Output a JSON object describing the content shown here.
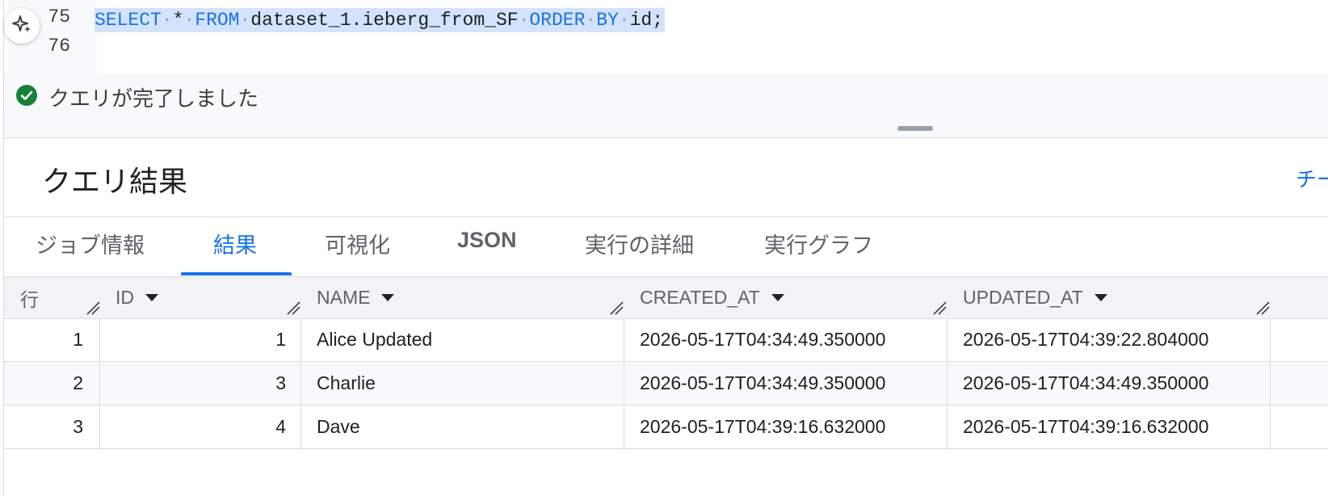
{
  "editor": {
    "lines": [
      {
        "number": "75",
        "tokens": [
          {
            "text": "SELECT",
            "kind": "keyword"
          },
          {
            "text": "·",
            "kind": "space"
          },
          {
            "text": "*",
            "kind": "plain"
          },
          {
            "text": "·",
            "kind": "space"
          },
          {
            "text": "FROM",
            "kind": "keyword"
          },
          {
            "text": "·",
            "kind": "space"
          },
          {
            "text": "dataset_1.ieberg_from_SF",
            "kind": "plain"
          },
          {
            "text": "·",
            "kind": "space"
          },
          {
            "text": "ORDER",
            "kind": "keyword"
          },
          {
            "text": "·",
            "kind": "space"
          },
          {
            "text": "BY",
            "kind": "keyword"
          },
          {
            "text": "·",
            "kind": "space"
          },
          {
            "text": "id;",
            "kind": "plain"
          }
        ],
        "selected": true
      },
      {
        "number": "76",
        "tokens": [],
        "selected": false
      }
    ],
    "ai_icon": "sparkle-icon"
  },
  "status": {
    "icon": "check-circle-icon",
    "text": "クエリが完了しました",
    "color": "#188038"
  },
  "results": {
    "title": "クエリ結果",
    "right_link": "チー"
  },
  "tabs": [
    {
      "label": "ジョブ情報",
      "active": false
    },
    {
      "label": "結果",
      "active": true
    },
    {
      "label": "可視化",
      "active": false
    },
    {
      "label": "JSON",
      "active": false
    },
    {
      "label": "実行の詳細",
      "active": false
    },
    {
      "label": "実行グラフ",
      "active": false
    }
  ],
  "table": {
    "columns": [
      "行",
      "ID",
      "NAME",
      "CREATED_AT",
      "UPDATED_AT"
    ],
    "sortable": [
      false,
      true,
      true,
      true,
      true
    ],
    "rows": [
      [
        "1",
        "1",
        "Alice Updated",
        "2026-05-17T04:34:49.350000",
        "2026-05-17T04:39:22.804000"
      ],
      [
        "2",
        "3",
        "Charlie",
        "2026-05-17T04:34:49.350000",
        "2026-05-17T04:34:49.350000"
      ],
      [
        "3",
        "4",
        "Dave",
        "2026-05-17T04:39:16.632000",
        "2026-05-17T04:39:16.632000"
      ]
    ]
  },
  "colors": {
    "accent": "#1a73e8",
    "selection": "#d3e3fd",
    "success": "#188038"
  }
}
